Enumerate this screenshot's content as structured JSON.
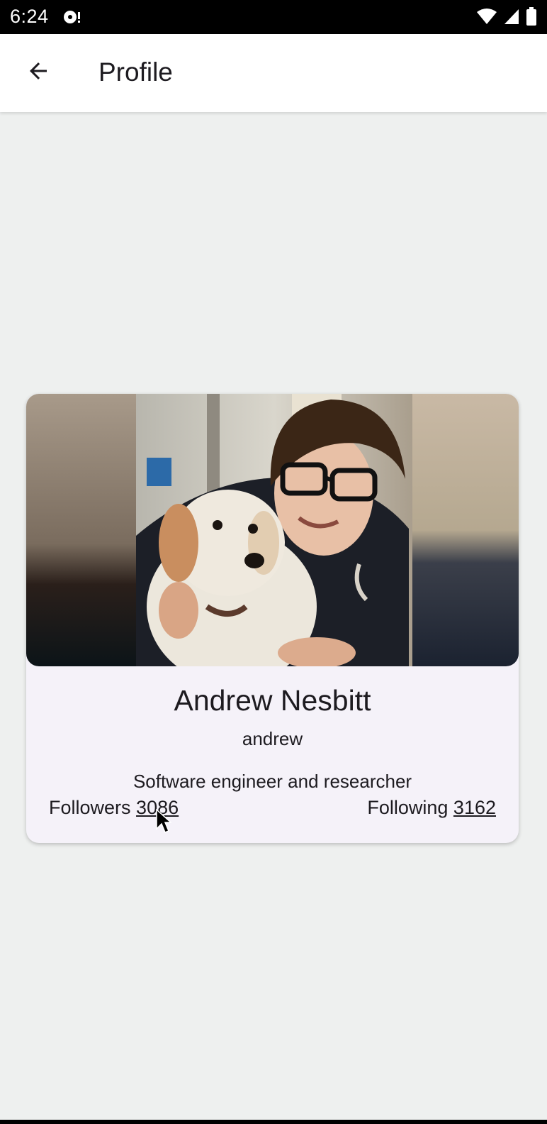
{
  "status_bar": {
    "time": "6:24"
  },
  "app_bar": {
    "title": "Profile"
  },
  "profile": {
    "name": "Andrew Nesbitt",
    "username": "andrew",
    "bio": "Software engineer and researcher",
    "followers_label": "Followers",
    "followers_count": "3086",
    "following_label": "Following",
    "following_count": "3162"
  },
  "colors": {
    "background": "#eef0ef",
    "card": "#f5f2f9",
    "text": "#1d1b20"
  }
}
